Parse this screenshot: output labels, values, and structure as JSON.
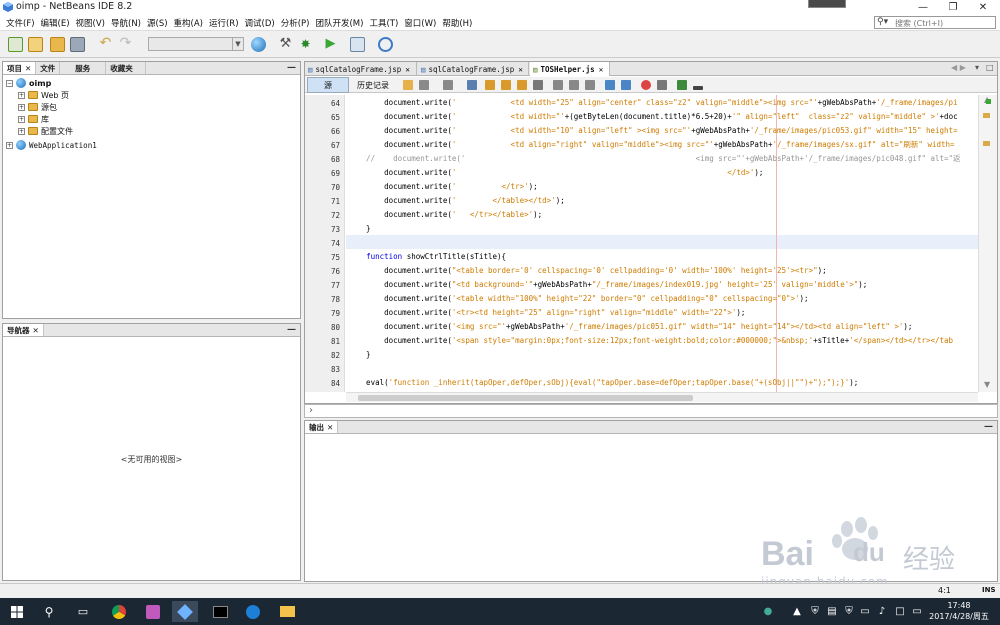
{
  "window": {
    "title": "oimp - NetBeans IDE 8.2"
  },
  "menu": [
    "文件(F)",
    "编辑(E)",
    "视图(V)",
    "导航(N)",
    "源(S)",
    "重构(A)",
    "运行(R)",
    "调试(D)",
    "分析(P)",
    "团队开发(M)",
    "工具(T)",
    "窗口(W)",
    "帮助(H)"
  ],
  "search": {
    "placeholder": "搜索 (Ctrl+I)"
  },
  "projects_panel": {
    "tabs": [
      "项目",
      "文件",
      "服务",
      "收藏夹"
    ],
    "tree": [
      {
        "label": "oimp",
        "level": 0,
        "kind": "project"
      },
      {
        "label": "Web 页",
        "level": 1,
        "kind": "folder"
      },
      {
        "label": "源包",
        "level": 1,
        "kind": "folder"
      },
      {
        "label": "库",
        "level": 1,
        "kind": "folder"
      },
      {
        "label": "配置文件",
        "level": 1,
        "kind": "folder"
      },
      {
        "label": "WebApplication1",
        "level": 0,
        "kind": "project"
      }
    ]
  },
  "navigator_panel": {
    "title": "导航器",
    "empty_text": "<无可用的视图>"
  },
  "editor": {
    "tabs": [
      {
        "label": "sqlCatalogFrame.jsp",
        "active": false
      },
      {
        "label": "sqlCatalogFrame.jsp",
        "active": false
      },
      {
        "label": "TOSHelper.js",
        "active": true
      }
    ],
    "modes": [
      "源",
      "历史记录"
    ],
    "lines": [
      {
        "n": "64",
        "t": "        document.write('            <td width=\"25\" align=\"center\" class=\"z2\" valign=\"middle\"><img src=\"'+gWebAbsPath+'/_frame/images/pi"
      },
      {
        "n": "65",
        "t": "        document.write('            <td width=\"'+(getByteLen(document.title)*6.5+20)+'\" align=\"left\"  class=\"z2\" valign=\"middle\" >'+doc"
      },
      {
        "n": "66",
        "t": "        document.write('            <td width=\"10\" align=\"left\" ><img src=\"'+gWebAbsPath+'/_frame/images/pic053.gif\" width=\"15\" height="
      },
      {
        "n": "67",
        "t": "        document.write('            <td align=\"right\" valign=\"middle\"><img src=\"'+gWebAbsPath+'/_frame/images/sx.gif\" alt=\"刷新\" width="
      },
      {
        "n": "68",
        "t": "    //    document.write('                                                   <img src=\"'+gWebAbsPath+'/_frame/images/pic048.gif\" alt=\"返"
      },
      {
        "n": "69",
        "t": "        document.write('                                                            </td>');"
      },
      {
        "n": "70",
        "t": "        document.write('          </tr>');"
      },
      {
        "n": "71",
        "t": "        document.write('        </table></td>');"
      },
      {
        "n": "72",
        "t": "        document.write('   </tr></table>');"
      },
      {
        "n": "73",
        "t": "    }"
      },
      {
        "n": "74",
        "t": ""
      },
      {
        "n": "75",
        "t": "    function showCtrlTitle(sTitle){"
      },
      {
        "n": "76",
        "t": "        document.write(\"<table border='0' cellspacing='0' cellpadding='0' width='100%' height='25'><tr>\");"
      },
      {
        "n": "77",
        "t": "        document.write(\"<td background='\"+gWebAbsPath+\"/_frame/images/index019.jpg' height='25' valign='middle'>\");"
      },
      {
        "n": "78",
        "t": "        document.write('<table width=\"100%\" height=\"22\" border=\"0\" cellpadding=\"0\" cellspacing=\"0\">');"
      },
      {
        "n": "79",
        "t": "        document.write('<tr><td height=\"25\" align=\"right\" valign=\"middle\" width=\"22\">');"
      },
      {
        "n": "80",
        "t": "        document.write('<img src=\"'+gWebAbsPath+'/_frame/images/pic051.gif\" width=\"14\" height=\"14\"></td><td align=\"left\" >');"
      },
      {
        "n": "81",
        "t": "        document.write('<span style=\"margin:0px;font-size:12px;font-weight:bold;color:#000000;\">&nbsp;'+sTitle+'</span></td></tr></tab"
      },
      {
        "n": "82",
        "t": "    }"
      },
      {
        "n": "83",
        "t": ""
      },
      {
        "n": "84",
        "t": "    eval('function _inherit(tapOper,defOper,sObj){eval(\"tapOper.base=defOper;tapOper.base(\"+(sObj||\"\")+\");\");}');"
      }
    ]
  },
  "output_panel": {
    "title": "输出"
  },
  "status": {
    "position": "4:1",
    "insert_mode": "INS"
  },
  "taskbar": {
    "time": "17:48",
    "date": "2017/4/28/周五"
  },
  "watermark": {
    "brand": "Bai",
    "brand2": "du",
    "cn": "经验",
    "url": "jingyan.baidu.com"
  },
  "colors": {
    "accent": "#1e6db6",
    "string": "#ce7b00",
    "keyword": "#0000e6",
    "comment": "#969696"
  }
}
